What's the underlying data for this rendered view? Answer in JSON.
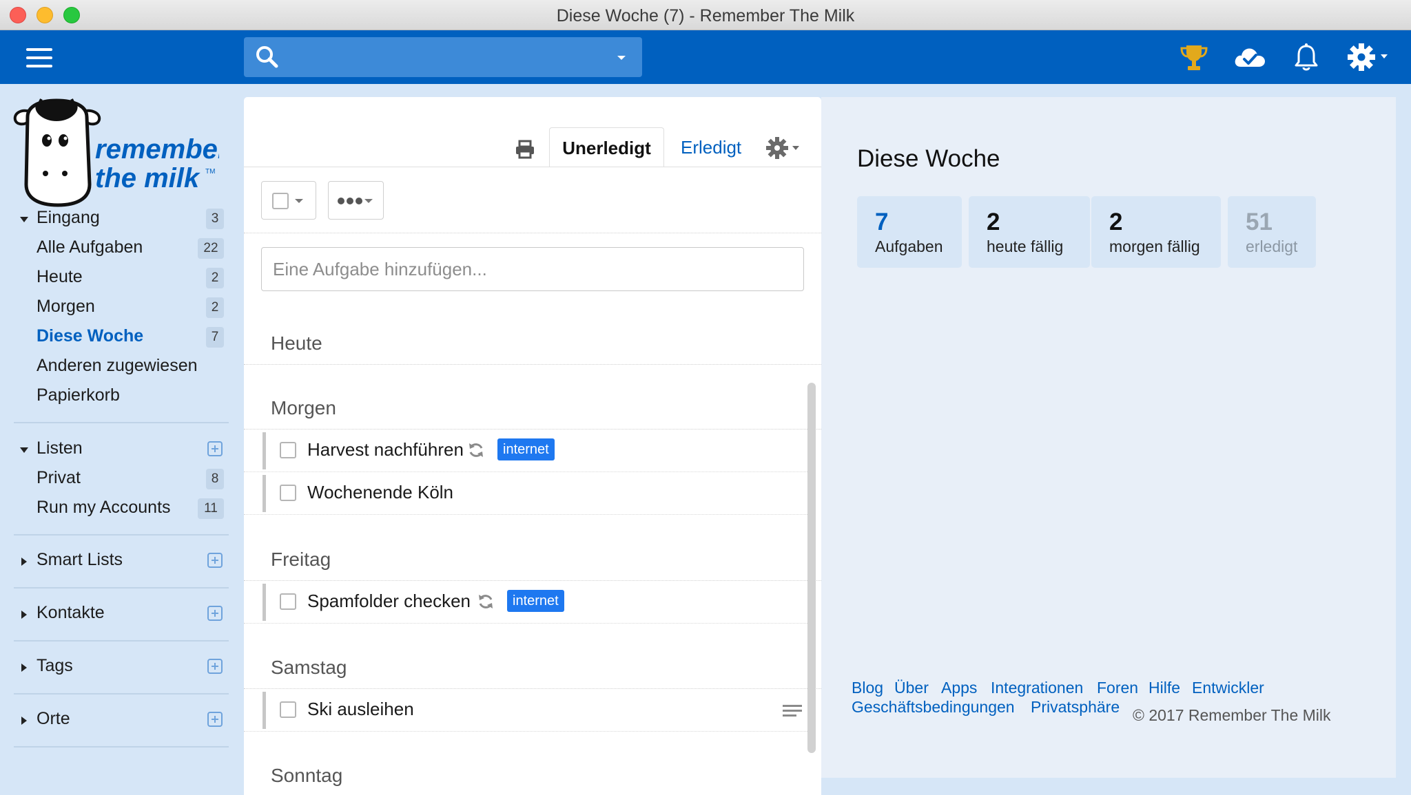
{
  "window": {
    "title": "Diese Woche (7) - Remember The Milk"
  },
  "colors": {
    "brand_blue": "#0060bf",
    "tag_blue": "#1e78f0",
    "sidebar_bg": "#d6e6f7",
    "trophy": "#e2a91c"
  },
  "search": {
    "placeholder": "",
    "value": ""
  },
  "toolbar": {
    "icons": [
      "menu-icon",
      "search-icon",
      "trophy-icon",
      "cloud-sync-icon",
      "bell-icon",
      "gear-icon"
    ]
  },
  "logo": {
    "line1": "remember",
    "line2": "the milk",
    "tm": "TM"
  },
  "sidebar": {
    "inbox": {
      "label": "Eingang",
      "count": "3",
      "items": [
        {
          "label": "Alle Aufgaben",
          "count": "22"
        },
        {
          "label": "Heute",
          "count": "2"
        },
        {
          "label": "Morgen",
          "count": "2"
        },
        {
          "label": "Diese Woche",
          "count": "7",
          "active": true
        },
        {
          "label": "Anderen zugewiesen",
          "count": ""
        },
        {
          "label": "Papierkorb",
          "count": ""
        }
      ]
    },
    "lists": {
      "label": "Listen",
      "items": [
        {
          "label": "Privat",
          "count": "8"
        },
        {
          "label": "Run my Accounts",
          "count": "11"
        }
      ]
    },
    "smart_lists": {
      "label": "Smart Lists"
    },
    "contacts": {
      "label": "Kontakte"
    },
    "tags": {
      "label": "Tags"
    },
    "places": {
      "label": "Orte"
    }
  },
  "tasklist": {
    "tabs": {
      "incomplete": "Unerledigt",
      "completed": "Erledigt"
    },
    "add_placeholder": "Eine Aufgabe hinzufügen...",
    "groups": [
      {
        "title": "Heute",
        "tasks": []
      },
      {
        "title": "Morgen",
        "tasks": [
          {
            "name": "Harvest nachführen",
            "repeat": true,
            "tag": "internet"
          },
          {
            "name": "Wochenende Köln",
            "repeat": false,
            "tag": ""
          }
        ]
      },
      {
        "title": "Freitag",
        "tasks": [
          {
            "name": "Spamfolder checken",
            "repeat": true,
            "tag": "internet"
          }
        ]
      },
      {
        "title": "Samstag",
        "tasks": [
          {
            "name": "Ski ausleihen",
            "repeat": false,
            "tag": "",
            "has_note": true
          }
        ]
      },
      {
        "title": "Sonntag",
        "tasks": []
      }
    ]
  },
  "details": {
    "title": "Diese Woche",
    "stats": [
      {
        "value": "7",
        "label": "Aufgaben"
      },
      {
        "value": "2",
        "label": "heute fällig"
      },
      {
        "value": "2",
        "label": "morgen fällig"
      },
      {
        "value": "51",
        "label": "erledigt"
      }
    ],
    "footer": {
      "links": [
        "Blog",
        "Über",
        "Apps",
        "Integrationen",
        "Foren",
        "Hilfe",
        "Entwickler",
        "Geschäftsbedingungen",
        "Privatsphäre"
      ],
      "copyright": "© 2017 Remember The Milk"
    }
  }
}
